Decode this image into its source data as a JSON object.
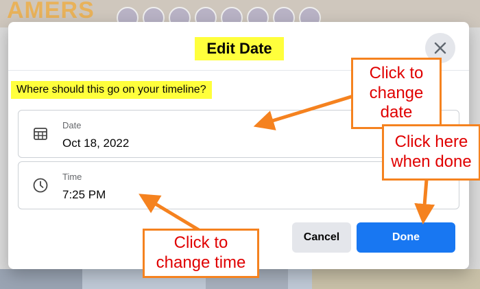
{
  "dialog": {
    "title": "Edit Date",
    "question": "Where should this go on your timeline?",
    "date_field": {
      "label": "Date",
      "value": "Oct 18, 2022"
    },
    "time_field": {
      "label": "Time",
      "value": "7:25 PM"
    },
    "cancel_label": "Cancel",
    "done_label": "Done"
  },
  "annotations": {
    "date": "Click to change date",
    "done": "Click here when done",
    "time": "Click to change time"
  },
  "background": {
    "logo_text": "AMERS"
  },
  "colors": {
    "highlight": "#ffff3c",
    "primary_button": "#1877f2",
    "callout_border": "#f5821f",
    "callout_text": "#e00000"
  },
  "icons": [
    "close-icon",
    "calendar-icon",
    "clock-icon"
  ]
}
